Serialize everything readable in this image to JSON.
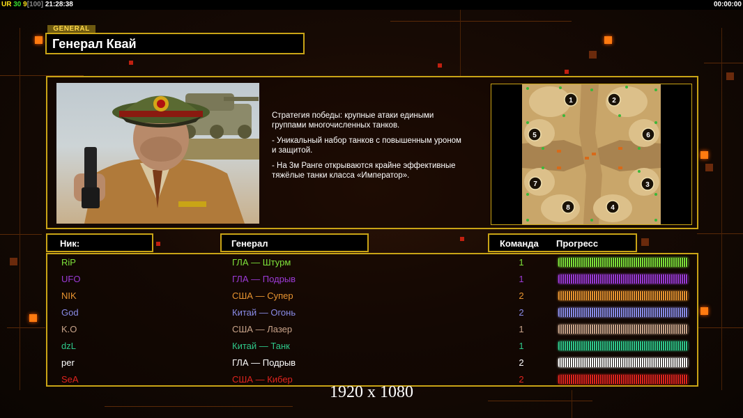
{
  "topbar": {
    "ur": "UR",
    "fps": "30",
    "nine": "9",
    "bracket": "[100]",
    "clock": "21:28:38",
    "timer": "00:00:00"
  },
  "general": {
    "tag": "GENERAL",
    "name": "Генерал Квай"
  },
  "strategy": [
    "Стратегия победы: крупные атаки едиными\n группами многочисленных танков.",
    "- Уникальный набор танков с повышенным уроном\n и защитой.",
    "- На 3м Ранге открываются крайне эффективные\n тяжёлые танки класса «Император»."
  ],
  "minimap": {
    "spawns": [
      "1",
      "2",
      "3",
      "4",
      "5",
      "6",
      "7",
      "8"
    ]
  },
  "table": {
    "headers": {
      "nick": "Ник:",
      "general": "Генерал",
      "team": "Команда",
      "progress": "Прогресс"
    },
    "players": [
      {
        "nick": "RiP",
        "general": "ГЛА — Штурм",
        "team": "1",
        "color": "#7ee23a",
        "progress": 1.0
      },
      {
        "nick": "UFO",
        "general": "ГЛА — Подрыв",
        "team": "1",
        "color": "#9c3ad6",
        "progress": 1.0
      },
      {
        "nick": "NIK",
        "general": "США — Супер",
        "team": "2",
        "color": "#e89430",
        "progress": 1.0
      },
      {
        "nick": "God",
        "general": "Китай — Огонь",
        "team": "2",
        "color": "#8a8ce8",
        "progress": 1.0
      },
      {
        "nick": "K.O",
        "general": "США — Лазер",
        "team": "1",
        "color": "#c9a48a",
        "progress": 1.0
      },
      {
        "nick": "dzL",
        "general": "Китай — Танк",
        "team": "1",
        "color": "#2ec88a",
        "progress": 1.0
      },
      {
        "nick": "per",
        "general": "ГЛА — Подрыв",
        "team": "2",
        "color": "#ffffff",
        "progress": 1.0
      },
      {
        "nick": "SeA",
        "general": "США — Кибер",
        "team": "2",
        "color": "#e0241e",
        "progress": 1.0
      }
    ]
  },
  "resolution": "1920 x 1080"
}
